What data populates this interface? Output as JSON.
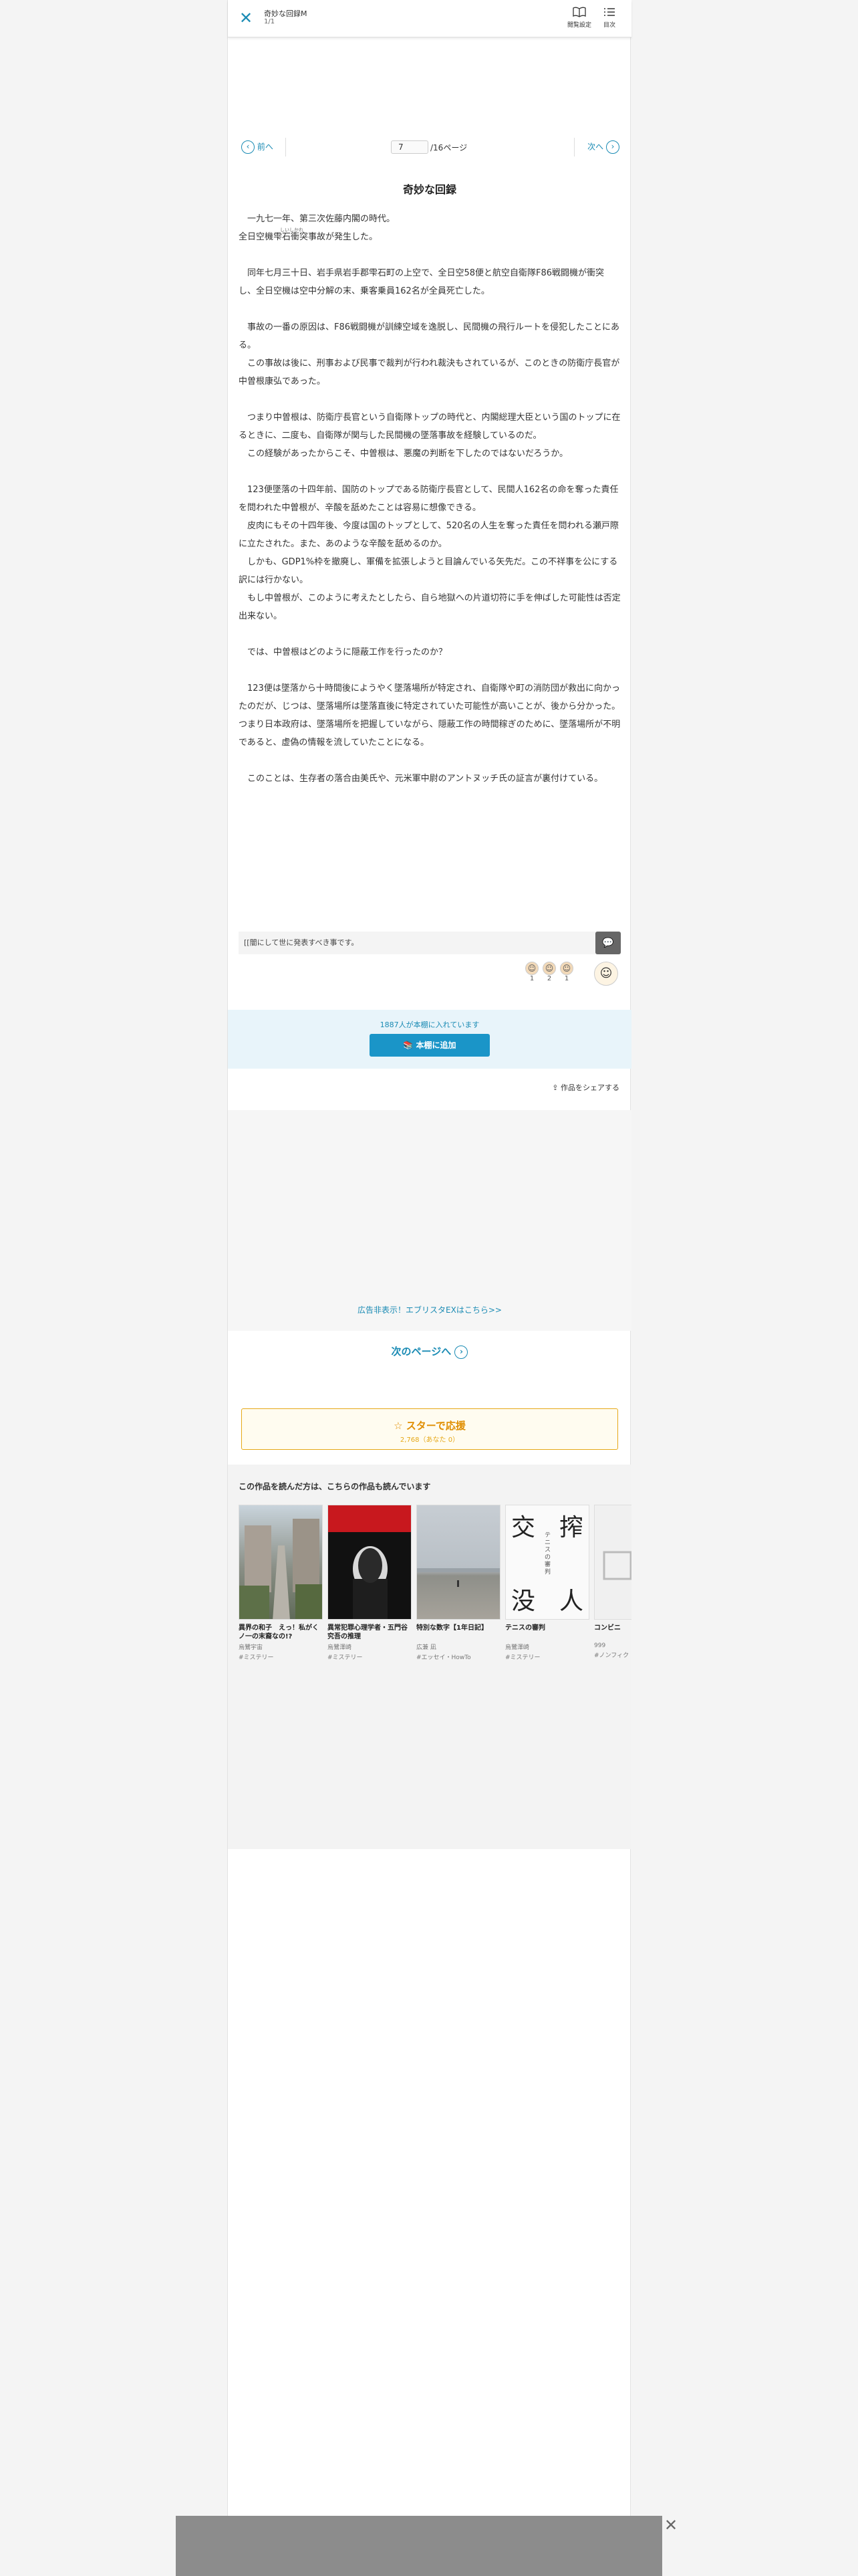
{
  "header": {
    "title": "奇妙な回録M",
    "subtitle": "1/1",
    "display_settings_label": "閲覧設定",
    "toc_label": "目次"
  },
  "pager": {
    "prev_label": "前へ",
    "next_label": "次へ",
    "current_page": "7",
    "total_label": "/16ページ"
  },
  "episode": {
    "title": "奇妙な回録",
    "ruby_text": "しいしかれ",
    "paragraphs": [
      "　一九七一年、第三次佐藤内閣の時代。",
      "全日空機雫石衝突事故が発生した。",
      "",
      "　同年七月三十日、岩手県岩手郡雫石町の上空で、全日空58便と航空自衛隊F86戦闘機が衝突し、全日空機は空中分解の末、乗客乗員162名が全員死亡した。",
      "",
      "　事故の一番の原因は、F86戦闘機が訓練空域を逸脱し、民間機の飛行ルートを侵犯したことにある。",
      "　この事故は後に、刑事および民事で裁判が行われ裁決もされているが、このときの防衛庁長官が中曽根康弘であった。",
      "",
      "　つまり中曽根は、防衛庁長官という自衛隊トップの時代と、内閣総理大臣という国のトップに在るときに、二度も、自衛隊が関与した民間機の墜落事故を経験しているのだ。",
      "　この経験があったからこそ、中曽根は、悪魔の判断を下したのではないだろうか。",
      "",
      "　123便墜落の十四年前、国防のトップである防衛庁長官として、民間人162名の命を奪った責任を問われた中曽根が、辛酸を舐めたことは容易に想像できる。",
      "　皮肉にもその十四年後、今度は国のトップとして、520名の人生を奪った責任を問われる瀬戸際に立たされた。また、あのような辛酸を舐めるのか。",
      "　しかも、GDP1%枠を撤廃し、軍備を拡張しようと目論んでいる矢先だ。この不祥事を公にする訳には行かない。",
      "　もし中曽根が、このように考えたとしたら、自ら地獄への片道切符に手を伸ばした可能性は否定出来ない。",
      "",
      "　では、中曽根はどのように隠蔽工作を行ったのか？",
      "",
      "　123便は墜落から十時間後にようやく墜落場所が特定され、自衛隊や町の消防団が救出に向かったのだが、じつは、墜落場所は墜落直後に特定されていた可能性が高いことが、後から分かった。",
      "つまり日本政府は、墜落場所を把握していながら、隠蔽工作の時間稼ぎのために、墜落場所が不明であると、虚偽の情報を流していたことになる。",
      "",
      "　このことは、生存者の落合由美氏や、元米軍中尉のアントヌッチ氏の証言が裏付けている。"
    ]
  },
  "comment": {
    "preview": "[[闇にして世に発表すべき事です。",
    "button_icon": "speech-bubble"
  },
  "reactions": [
    {
      "count": "1",
      "icon": "face"
    },
    {
      "count": "2",
      "icon": "face"
    },
    {
      "count": "1",
      "icon": "face"
    }
  ],
  "shelf": {
    "count_text": "1887人が本棚に入れています",
    "button_label": "本棚に追加"
  },
  "share_label": "作品をシェアする",
  "ad_link_label": "広告非表示！エブリスタEXはこちら>>",
  "next_page_label": "次のページへ",
  "star": {
    "label": "スターで応援",
    "count": "2,768（あなた 0）"
  },
  "recommendations": {
    "title": "この作品を読んだ方は、こちらの作品も読んでいます",
    "items": [
      {
        "title": "異界の和子　えっ！私がくノ一の末裔なの!?",
        "author": "烏鷺宇宙",
        "genre": "#ミステリー",
        "cover": "street"
      },
      {
        "title": "異常犯罪心理学者・五門谷究吾の推理",
        "author": "烏鷺澤崎",
        "genre": "#ミステリー",
        "cover": "dark"
      },
      {
        "title": "特別な数字【1年日記】",
        "author": "広兼 凪",
        "genre": "#エッセイ・HowTo",
        "cover": "beach"
      },
      {
        "title": "テニスの審判",
        "author": "烏鷺澤崎",
        "genre": "#ミステリー",
        "cover": "kanji"
      },
      {
        "title": "コンビニ",
        "author": "999",
        "genre": "#ノンフィク",
        "cover": "plain"
      }
    ],
    "cover_kanji": [
      "交",
      "搾",
      "没",
      "人"
    ],
    "cover_sub": "テニスの審判"
  }
}
